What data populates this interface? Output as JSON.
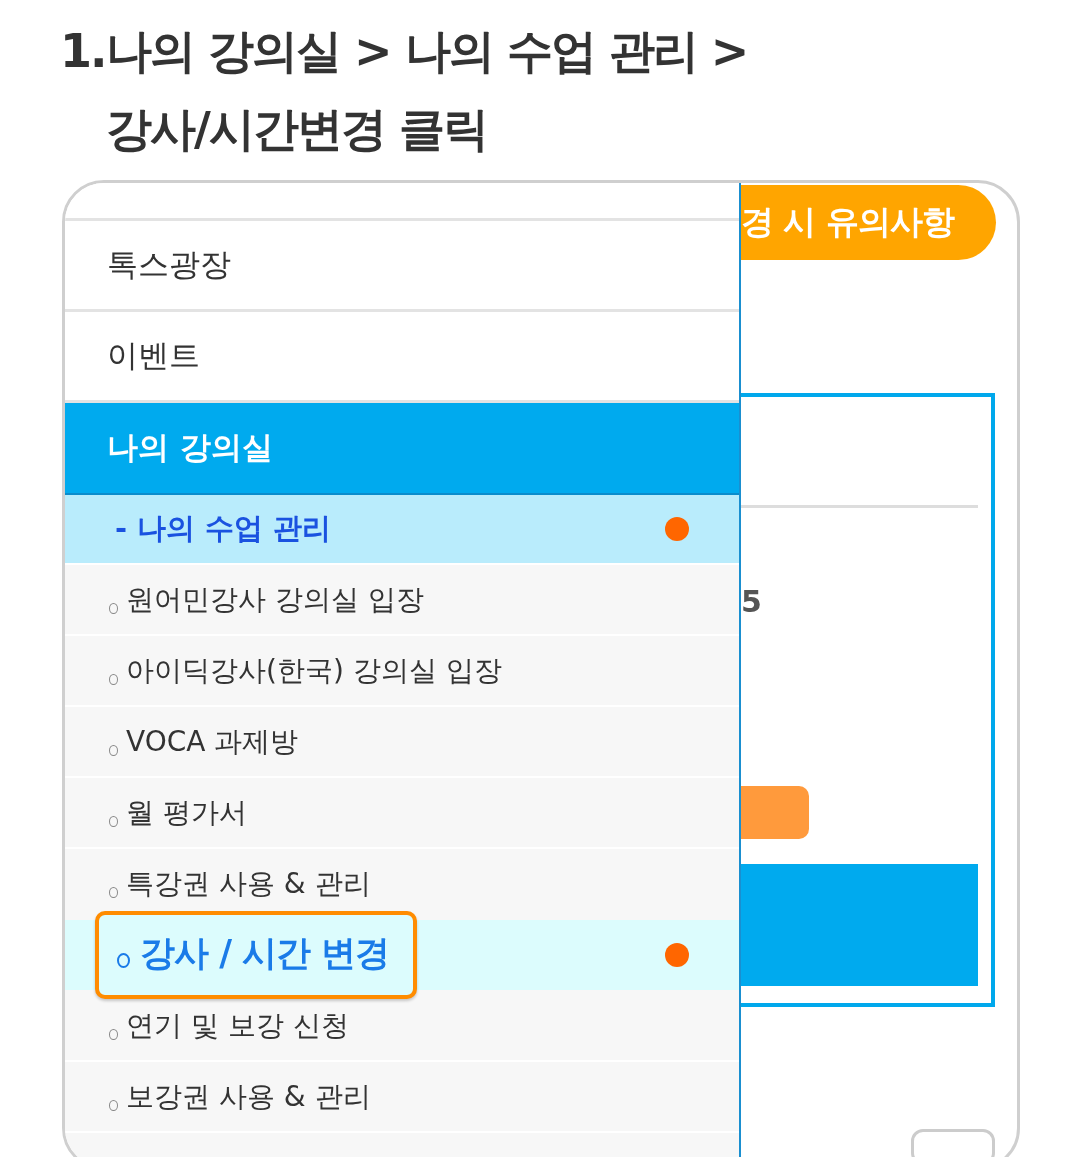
{
  "heading": {
    "number": "1.",
    "lines": [
      "나의 강의실 > 나의 수업 관리 >",
      "강사/시간변경 클릭"
    ]
  },
  "menu": {
    "items": [
      {
        "kind": "cut"
      },
      {
        "kind": "top",
        "label": "톡스광장"
      },
      {
        "kind": "top",
        "label": "이벤트"
      },
      {
        "kind": "section",
        "label": "나의 강의실"
      },
      {
        "kind": "group",
        "label": "- 나의 수업 관리",
        "selected": true
      },
      {
        "kind": "sub",
        "label": "원어민강사 강의실 입장",
        "selected": false
      },
      {
        "kind": "sub",
        "label": "아이딕강사(한국) 강의실 입장",
        "selected": false
      },
      {
        "kind": "sub",
        "label": "VOCA 과제방",
        "selected": false
      },
      {
        "kind": "sub",
        "label": "월 평가서",
        "selected": false
      },
      {
        "kind": "sub",
        "label": "특강권 사용 & 관리",
        "selected": false
      },
      {
        "kind": "sub",
        "label": "강사 / 시간 변경",
        "selected": true
      },
      {
        "kind": "sub",
        "label": "연기 및 보강 신청",
        "selected": false
      },
      {
        "kind": "sub",
        "label": "보강권 사용 & 관리",
        "selected": false
      }
    ]
  },
  "background_page": {
    "notice_button": "경 시 유의사항",
    "value_text": "5"
  }
}
